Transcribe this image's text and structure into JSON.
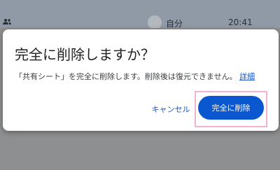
{
  "background": {
    "contact_name": "自分",
    "time": "20:41"
  },
  "dialog": {
    "title": "完全に削除しますか？",
    "message": "「共有シート」を完全に削除します。削除後は復元できません。",
    "details_link": "詳細",
    "cancel_label": "キャンセル",
    "confirm_label": "完全に削除"
  },
  "colors": {
    "primary": "#0b57d0",
    "link": "#1a57c8",
    "focus_highlight": "#f1b4cf"
  }
}
